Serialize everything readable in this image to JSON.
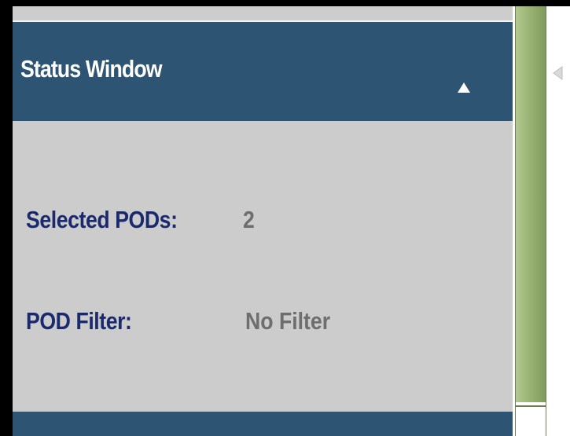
{
  "status_window": {
    "title": "Status Window",
    "collapse_icon": "triangle-up-icon",
    "rows": [
      {
        "label": "Selected PODs:",
        "value": "2"
      },
      {
        "label": "POD Filter:",
        "value": "No Filter"
      }
    ]
  },
  "splitter": {
    "expand_icon": "triangle-left-icon"
  },
  "colors": {
    "header_bg": "#2e5473",
    "panel_bg": "#cccccc",
    "label_text": "#1b2a6e",
    "value_text": "#6e6e6e",
    "splitter_green": "#9fb87a"
  }
}
